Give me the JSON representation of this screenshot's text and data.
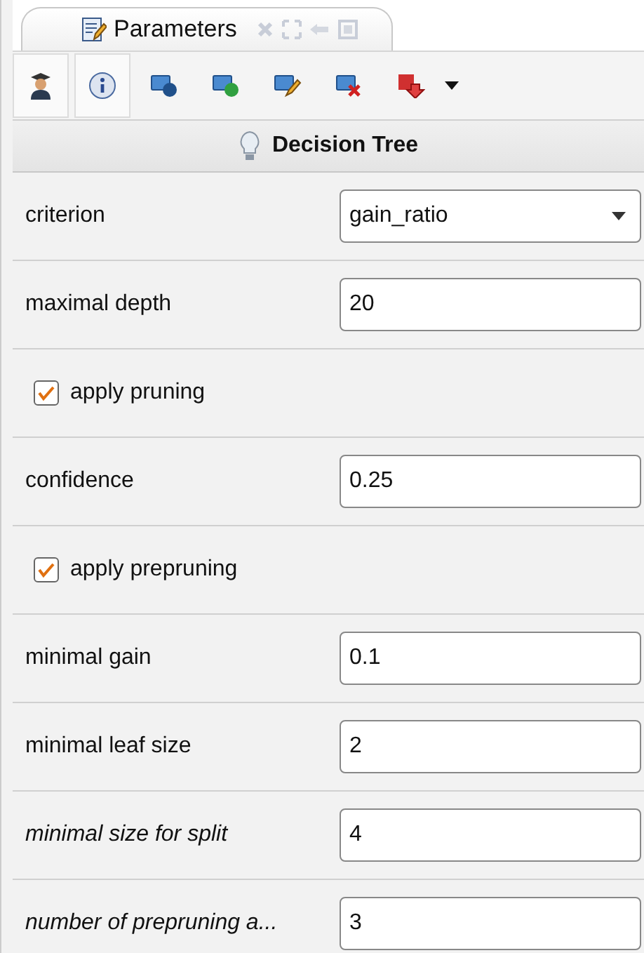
{
  "tab": {
    "title": "Parameters"
  },
  "toolbar": [
    {
      "kind": "expert",
      "selected": true
    },
    {
      "kind": "info",
      "selected": true
    },
    {
      "kind": "details",
      "selected": false
    },
    {
      "kind": "validate",
      "selected": false
    },
    {
      "kind": "edit",
      "selected": false
    },
    {
      "kind": "remove",
      "selected": false
    },
    {
      "kind": "export",
      "selected": false
    }
  ],
  "operator": {
    "title": "Decision Tree"
  },
  "parameters": [
    {
      "kind": "dropdown",
      "label": "criterion",
      "value": "gain_ratio",
      "italic": false
    },
    {
      "kind": "text",
      "label": "maximal depth",
      "value": "20",
      "italic": false
    },
    {
      "kind": "checkbox",
      "label": "apply pruning",
      "checked": true
    },
    {
      "kind": "text",
      "label": "confidence",
      "value": "0.25",
      "italic": false
    },
    {
      "kind": "checkbox",
      "label": "apply prepruning",
      "checked": true
    },
    {
      "kind": "text",
      "label": "minimal gain",
      "value": "0.1",
      "italic": false
    },
    {
      "kind": "text",
      "label": "minimal leaf size",
      "value": "2",
      "italic": false
    },
    {
      "kind": "text",
      "label": "minimal size for split",
      "value": "4",
      "italic": true
    },
    {
      "kind": "text",
      "label": "number of prepruning a...",
      "value": "3",
      "italic": true
    }
  ]
}
